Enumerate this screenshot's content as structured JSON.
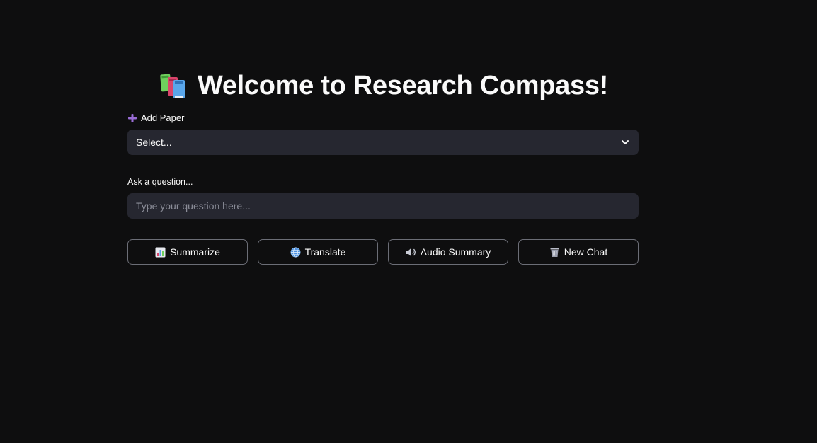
{
  "header": {
    "title": "Welcome to Research Compass!",
    "title_icon": "books-icon"
  },
  "add_paper": {
    "label": "Add Paper",
    "icon": "plus-icon",
    "icon_color": "#9a6dd7"
  },
  "paper_select": {
    "selected_value": "Select...",
    "icon": "chevron-down-icon"
  },
  "question": {
    "label": "Ask a question...",
    "placeholder": "Type your question here...",
    "value": ""
  },
  "actions": [
    {
      "label": "Summarize",
      "icon": "bar-chart-icon"
    },
    {
      "label": "Translate",
      "icon": "globe-icon"
    },
    {
      "label": "Audio Summary",
      "icon": "speaker-icon"
    },
    {
      "label": "New Chat",
      "icon": "wastebasket-icon"
    }
  ],
  "colors": {
    "background": "#0e0e0f",
    "input_background": "#262730",
    "button_border": "#6b6d76",
    "text": "#fafafa",
    "placeholder": "#8b8d98"
  }
}
